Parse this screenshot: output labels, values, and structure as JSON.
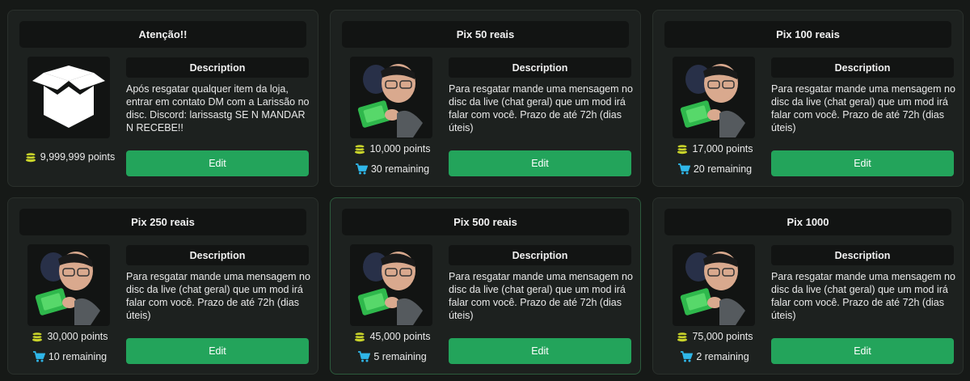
{
  "cards": [
    {
      "title": "Atenção!!",
      "image": "box-icon",
      "description_label": "Description",
      "description": "Após resgatar qualquer item da loja, entrar em contato DM com a Larissão no disc. Discord: larissastg SE N MANDAR N RECEBE!!",
      "points": "9,999,999 points",
      "remaining": null,
      "button_label": "Edit"
    },
    {
      "title": "Pix 50 reais",
      "image": "streamer-avatar",
      "description_label": "Description",
      "description": "Para resgatar mande uma mensagem no disc da live (chat geral) que um mod irá falar com você. Prazo de até 72h (dias úteis)",
      "points": "10,000 points",
      "remaining": "30 remaining",
      "button_label": "Edit"
    },
    {
      "title": "Pix 100 reais",
      "image": "streamer-avatar",
      "description_label": "Description",
      "description": "Para resgatar mande uma mensagem no disc da live (chat geral) que um mod irá falar com você. Prazo de até 72h (dias úteis)",
      "points": "17,000 points",
      "remaining": "20 remaining",
      "button_label": "Edit"
    },
    {
      "title": "Pix 250 reais",
      "image": "streamer-avatar",
      "description_label": "Description",
      "description": "Para resgatar mande uma mensagem no disc da live (chat geral) que um mod irá falar com você. Prazo de até 72h (dias úteis)",
      "points": "30,000 points",
      "remaining": "10 remaining",
      "button_label": "Edit"
    },
    {
      "title": "Pix 500 reais",
      "image": "streamer-avatar",
      "description_label": "Description",
      "description": "Para resgatar mande uma mensagem no disc da live (chat geral) que um mod irá falar com você. Prazo de até 72h (dias úteis)",
      "points": "45,000 points",
      "remaining": "5 remaining",
      "button_label": "Edit"
    },
    {
      "title": "Pix 1000",
      "image": "streamer-avatar",
      "description_label": "Description",
      "description": "Para resgatar mande uma mensagem no disc da live (chat geral) que um mod irá falar com você. Prazo de até 72h (dias úteis)",
      "points": "75,000 points",
      "remaining": "2 remaining",
      "button_label": "Edit"
    }
  ],
  "icons": {
    "points": "coin-stack-icon",
    "remaining": "cart-icon"
  },
  "colors": {
    "accent": "#23a45b",
    "coin": "#c9d42a",
    "cart": "#2fb6e8",
    "card_bg": "#1d211f",
    "header_bg": "#121413"
  }
}
